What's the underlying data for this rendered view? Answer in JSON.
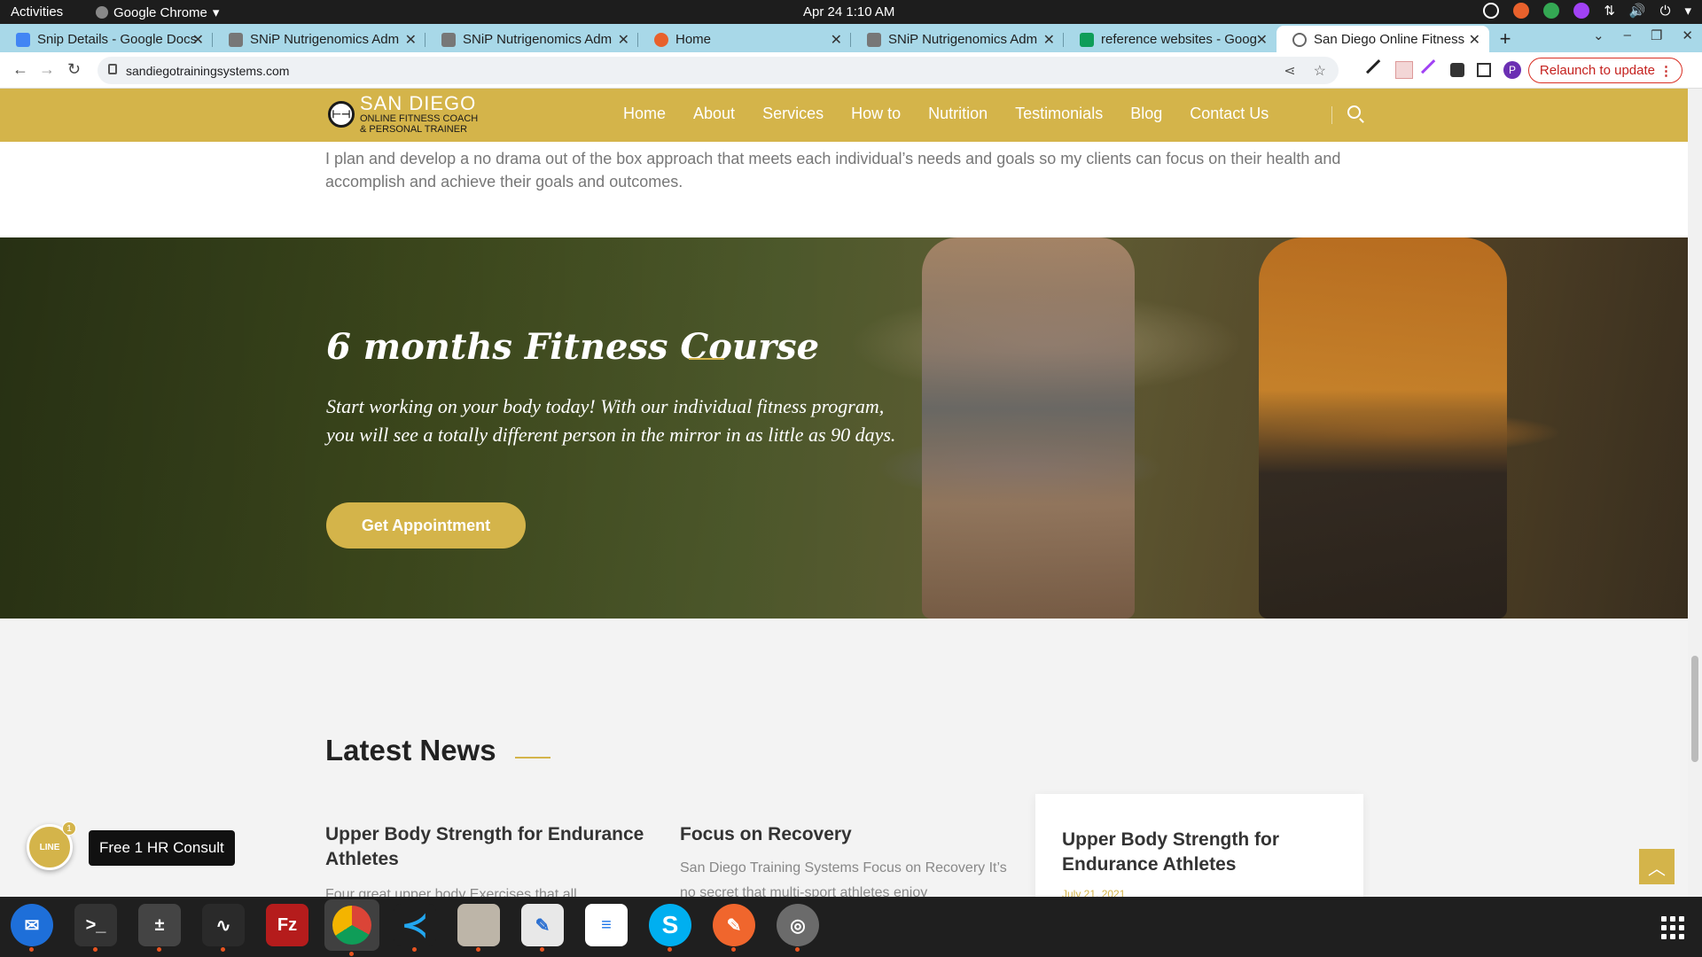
{
  "os": {
    "activities": "Activities",
    "app_name": "Google Chrome",
    "clock": "Apr 24  1:10 AM"
  },
  "tabs": [
    {
      "title": "Snip Details - Google Docs",
      "color": "#4285f4"
    },
    {
      "title": "SNiP Nutrigenomics Adm",
      "color": "#555555"
    },
    {
      "title": "SNiP Nutrigenomics Adm",
      "color": "#555555"
    },
    {
      "title": "Home",
      "color": "#e8612c"
    },
    {
      "title": "SNiP Nutrigenomics Adm",
      "color": "#555555"
    },
    {
      "title": "reference websites - Goog",
      "color": "#0f9d58"
    },
    {
      "title": "San Diego Online Fitness",
      "color": "#666666",
      "active": true
    }
  ],
  "browser": {
    "url": "sandiegotrainingsystems.com",
    "relaunch": "Relaunch to update",
    "profile_initial": "P"
  },
  "site": {
    "logo": {
      "line1": "SAN DIEGO",
      "line2": "ONLINE FITNESS COACH",
      "line3": "& PERSONAL TRAINER"
    },
    "menu": [
      "Home",
      "About",
      "Services",
      "How to",
      "Nutrition",
      "Testimonials",
      "Blog",
      "Contact Us"
    ],
    "intro": "I plan and develop a no drama out of the box approach that meets each individual’s needs and goals so my clients can focus on their health and accomplish and achieve their goals and outcomes.",
    "hero": {
      "title": "6 months Fitness Course",
      "text": "Start working on your body today! With our individual fitness program, you will see a totally different person in the mirror in as little as 90 days.",
      "button": "Get Appointment"
    },
    "news": {
      "title": "Latest News",
      "cards": [
        {
          "title": "Upper Body Strength for Endurance Athletes",
          "text": "Four great upper body Exercises that all"
        },
        {
          "title": "Focus on Recovery",
          "text": "San Diego Training Systems Focus on Recovery It’s no secret that multi-sport athletes enjoy"
        },
        {
          "title": "Upper Body Strength for Endurance Athletes",
          "date": "July 21, 2021"
        }
      ]
    },
    "widget": {
      "line_label": "LINE",
      "badge": "1",
      "consult": "Free 1 HR Consult"
    },
    "accent": "#d4b44a"
  }
}
